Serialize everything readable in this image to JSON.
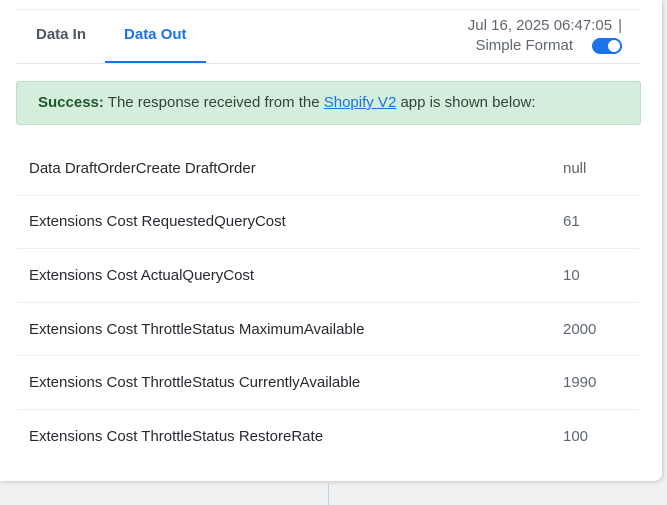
{
  "tabs": [
    {
      "label": "Data In",
      "active": false
    },
    {
      "label": "Data Out",
      "active": true
    }
  ],
  "meta": {
    "timestamp": "Jul 16, 2025 06:47:05",
    "separator": "|",
    "format_label": "Simple Format",
    "format_enabled": true
  },
  "alert": {
    "strong": "Success:",
    "text_before": "The response received from the",
    "link": "Shopify V2",
    "text_after": "app is shown below:"
  },
  "rows": [
    {
      "key": "Data DraftOrderCreate DraftOrder",
      "value": "null"
    },
    {
      "key": "Extensions Cost RequestedQueryCost",
      "value": "61"
    },
    {
      "key": "Extensions Cost ActualQueryCost",
      "value": "10"
    },
    {
      "key": "Extensions Cost ThrottleStatus MaximumAvailable",
      "value": "2000"
    },
    {
      "key": "Extensions Cost ThrottleStatus CurrentlyAvailable",
      "value": "1990"
    },
    {
      "key": "Extensions Cost ThrottleStatus RestoreRate",
      "value": "100"
    }
  ],
  "colors": {
    "accent": "#1a73e8",
    "success_bg": "#d5eedc"
  }
}
